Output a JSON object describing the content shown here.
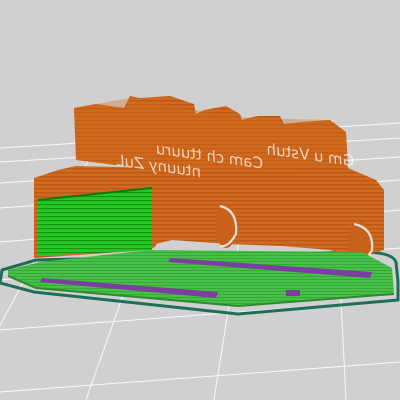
{
  "viewer": {
    "name": "3d-print-preview",
    "background_color": "#d0d0d0",
    "grid_color": "#ffffff"
  },
  "model": {
    "body_color": "#d2691e",
    "body_stripe_color": "#b85a16",
    "body_highlight_color": "#e07a2c",
    "window_color": "#22cc22",
    "window_stripe_color": "#129c12",
    "base_plate_color": "#3fbf3f",
    "base_plate_edge_color": "#2e8a2e",
    "skirt_color": "#1f6e5a",
    "slot_color": "#7b3fa0",
    "embossed_text_lines": [
      "Gm u Vstuh",
      "Cam ch ttuuru",
      "ntuuny ZuL"
    ],
    "embossed_lettering_in_logo": true
  }
}
